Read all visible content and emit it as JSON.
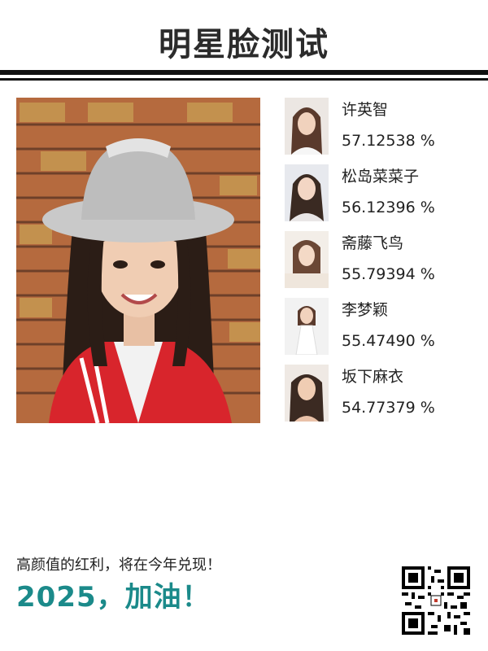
{
  "title": "明星脸测试",
  "matches": [
    {
      "name": "许英智",
      "score": "57.12538 %"
    },
    {
      "name": "松岛菜菜子",
      "score": "56.12396 %"
    },
    {
      "name": "斋藤飞鸟",
      "score": "55.79394 %"
    },
    {
      "name": "李梦颖",
      "score": "55.47490 %"
    },
    {
      "name": "坂下麻衣",
      "score": "54.77379 %"
    }
  ],
  "footer": {
    "slogan": "高颜值的红利，将在今年兑现！",
    "banner": "2025，加油！"
  },
  "colors": {
    "accent": "#1b8a8a",
    "brick": "#b6693a",
    "jacket": "#d8252c"
  }
}
